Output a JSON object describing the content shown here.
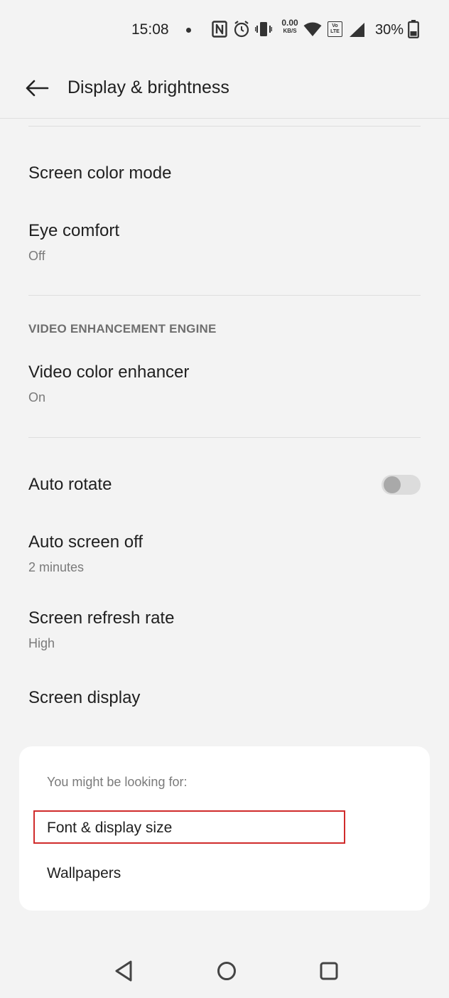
{
  "status_bar": {
    "time": "15:08",
    "net_speed_value": "0.00",
    "net_speed_unit": "KB/S",
    "volte_line1": "Vo",
    "volte_line2": "LTE",
    "battery_percent": "30%",
    "icons": [
      "notification-dot-icon",
      "nfc-icon",
      "alarm-icon",
      "vibrate-icon",
      "wifi-icon",
      "signal-icon",
      "battery-icon"
    ]
  },
  "header": {
    "title": "Display & brightness",
    "back_icon": "arrow-back-icon"
  },
  "settings": {
    "screen_color_mode": {
      "title": "Screen color mode"
    },
    "eye_comfort": {
      "title": "Eye comfort",
      "value": "Off"
    },
    "video_section_header": "VIDEO ENHANCEMENT ENGINE",
    "video_color_enhancer": {
      "title": "Video color enhancer",
      "value": "On"
    },
    "auto_rotate": {
      "title": "Auto rotate",
      "enabled": false
    },
    "auto_screen_off": {
      "title": "Auto screen off",
      "value": "2 minutes"
    },
    "screen_refresh_rate": {
      "title": "Screen refresh rate",
      "value": "High"
    },
    "screen_display": {
      "title": "Screen display"
    }
  },
  "suggestions": {
    "heading": "You might be looking for:",
    "items": [
      "Font & display size",
      "Wallpapers"
    ],
    "highlight_color": "#d02b2b"
  },
  "nav_bar": {
    "icons": [
      "nav-back-icon",
      "nav-home-icon",
      "nav-recents-icon"
    ]
  },
  "colors": {
    "background": "#f3f3f3",
    "card": "#ffffff",
    "primary_text": "#1f1f1f",
    "secondary_text": "#7a7a7a"
  }
}
